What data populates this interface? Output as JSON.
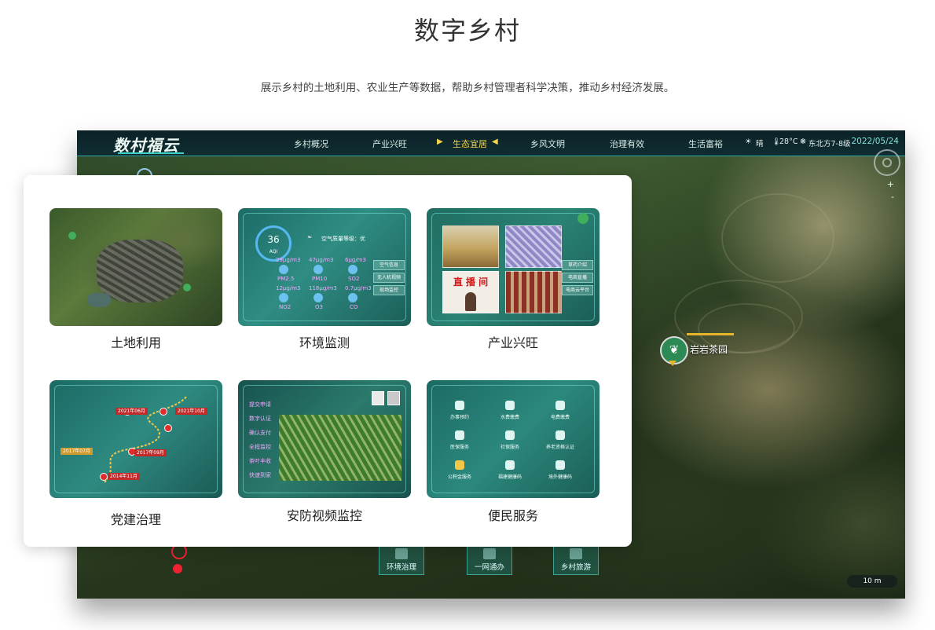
{
  "page": {
    "title": "数字乡村",
    "subtitle": "展示乡村的土地利用、农业生产等数据，帮助乡村管理者科学决策，推动乡村经济发展。"
  },
  "dashboard": {
    "logo": "数村福云",
    "nav": [
      "乡村概况",
      "产业兴旺",
      "生态宜居",
      "乡风文明",
      "治理有效",
      "生活富裕"
    ],
    "active_nav": "生态宜居",
    "weather": {
      "condition": "晴",
      "temperature": "28°C",
      "wind": "东北方7-8级"
    },
    "date": "2022/05/24",
    "poi_label": "岩岩茶园",
    "bottom_buttons": [
      "环境治理",
      "一网通办",
      "乡村旅游"
    ],
    "scale": "10 m",
    "zoom_in": "+",
    "zoom_out": "-"
  },
  "features": [
    {
      "label": "土地利用"
    },
    {
      "label": "环境监测"
    },
    {
      "label": "产业兴旺"
    },
    {
      "label": "党建治理"
    },
    {
      "label": "安防视频监控"
    },
    {
      "label": "便民服务"
    }
  ],
  "env_thumb": {
    "aqi": "36",
    "aqi_label": "AQI",
    "quality": "空气质量等级：优",
    "metrics": [
      "PM2.5",
      "PM10",
      "SO2",
      "NO2",
      "O3",
      "CO"
    ],
    "values": [
      "29μg/m3",
      "47μg/m3",
      "6μg/m3",
      "12μg/m3",
      "118μg/m3",
      "0.7μg/m3"
    ],
    "buttons": [
      "空气信息",
      "无人机视频",
      "现场监控"
    ]
  },
  "ind_thumb": {
    "live": "直 播 间",
    "buttons": [
      "草药介绍",
      "电商直播",
      "电商云平台"
    ]
  },
  "party_thumb": {
    "tags": [
      "2021年06月",
      "2021年10月",
      "2017年07月",
      "2017年09月",
      "2014年11月"
    ]
  },
  "svc_thumb": {
    "items": [
      "办事预约",
      "水费缴费",
      "电费缴费",
      "医保服务",
      "社保服务",
      "养老资格认证",
      "公积金服务",
      "福建健康码",
      "境外健康码"
    ]
  },
  "sec_thumb": {
    "menu": [
      "提交申请",
      "数字认证",
      "确认支付",
      "全程监控",
      "茶叶丰收",
      "快速到家"
    ]
  }
}
